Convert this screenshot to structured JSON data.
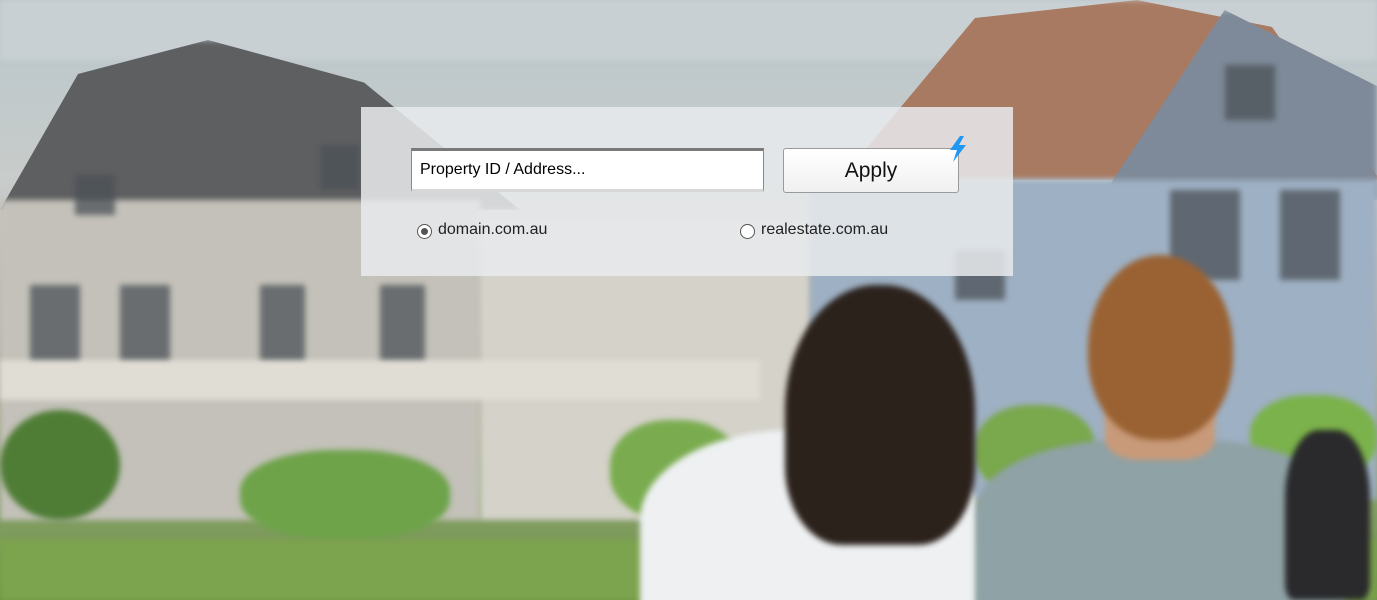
{
  "search": {
    "placeholder": "Property ID / Address...",
    "value": ""
  },
  "apply_button": {
    "label": "Apply"
  },
  "radio_options": [
    {
      "label": "domain.com.au",
      "selected": true
    },
    {
      "label": "realestate.com.au",
      "selected": false
    }
  ],
  "icons": {
    "bolt": "bolt-icon"
  },
  "colors": {
    "bolt": "#2196f3",
    "panel": "#e8eaec"
  }
}
